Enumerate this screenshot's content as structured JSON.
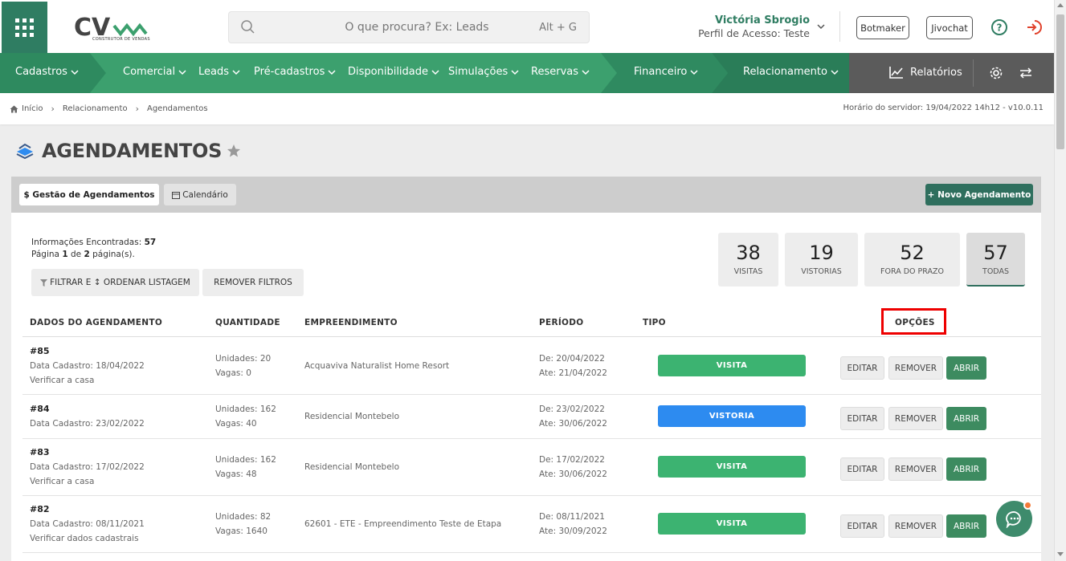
{
  "colors": {
    "brand": "#3ca06e",
    "brand_dark": "#2f7d62",
    "visita": "#3cb371",
    "vistoria": "#2d8bf0",
    "open": "#3d8b60",
    "highlight": "#ee0000"
  },
  "header": {
    "logo_sub": "CONSTRUTOR DE VENDAS",
    "search": {
      "placeholder": "O que procura? Ex: Leads",
      "shortcut": "Alt + G"
    },
    "user": {
      "name": "Victória Sbrogio",
      "role": "Perfil de Acesso: Teste"
    },
    "buttons": {
      "botmaker": "Botmaker",
      "jivochat": "Jivochat"
    }
  },
  "nav": {
    "cadastros": "Cadastros",
    "comercial": "Comercial",
    "leads": "Leads",
    "pre_cadastros": "Pré-cadastros",
    "disponibilidade": "Disponibilidade",
    "simulacoes": "Simulações",
    "reservas": "Reservas",
    "financeiro": "Financeiro",
    "relacionamento": "Relacionamento",
    "relatorios": "Relatórios"
  },
  "breadcrumb": {
    "home": "Início",
    "section": "Relacionamento",
    "current": "Agendamentos"
  },
  "server_time": "Horário do servidor: 19/04/2022 14h12 - v10.0.11",
  "page": {
    "title": "AGENDAMENTOS"
  },
  "tabs": {
    "gestao": "$ Gestão de Agendamentos",
    "calendario": "Calendário"
  },
  "new_button": "+ Novo Agendamento",
  "info": {
    "found_label": "Informações Encontradas:",
    "found_count": "57",
    "page_label": "Página",
    "page_current": "1",
    "page_of": "de",
    "page_total": "2",
    "page_suffix": "página(s)."
  },
  "filters": {
    "filter_order": "FILTRAR E ↕ ORDENAR LISTAGEM",
    "remove": "REMOVER FILTROS"
  },
  "stats": [
    {
      "num": "38",
      "label": "VISITAS"
    },
    {
      "num": "19",
      "label": "VISTORIAS"
    },
    {
      "num": "52",
      "label": "FORA DO PRAZO"
    },
    {
      "num": "57",
      "label": "TODAS"
    }
  ],
  "table": {
    "headers": [
      "DADOS DO AGENDAMENTO",
      "QUANTIDADE",
      "EMPREENDIMENTO",
      "PERÍODO",
      "TIPO",
      "OPÇÕES"
    ],
    "actions": {
      "edit": "EDITAR",
      "remove": "REMOVER",
      "open": "ABRIR"
    },
    "rows": [
      {
        "id": "#85",
        "cadastro": "Data Cadastro: 18/04/2022",
        "desc": "Verificar a casa",
        "unidades": "Unidades: 20",
        "vagas": "Vagas: 0",
        "empreendimento": "Acquaviva Naturalist Home Resort",
        "de": "De: 20/04/2022",
        "ate": "Ate: 21/04/2022",
        "tipo": "VISITA"
      },
      {
        "id": "#84",
        "cadastro": "Data Cadastro: 23/02/2022",
        "desc": "",
        "unidades": "Unidades: 162",
        "vagas": "Vagas: 40",
        "empreendimento": "Residencial Montebelo",
        "de": "De: 23/02/2022",
        "ate": "Ate: 30/06/2022",
        "tipo": "VISTORIA"
      },
      {
        "id": "#83",
        "cadastro": "Data Cadastro: 17/02/2022",
        "desc": "Verificar a casa",
        "unidades": "Unidades: 162",
        "vagas": "Vagas: 48",
        "empreendimento": "Residencial Montebelo",
        "de": "De: 17/02/2022",
        "ate": "Ate: 30/06/2022",
        "tipo": "VISITA"
      },
      {
        "id": "#82",
        "cadastro": "Data Cadastro: 08/11/2021",
        "desc": "Verificar dados cadastrais",
        "unidades": "Unidades: 82",
        "vagas": "Vagas: 1640",
        "empreendimento": "62601 - ETE - Empreendimento Teste de Etapa",
        "de": "De: 08/11/2021",
        "ate": "Ate: 30/09/2022",
        "tipo": "VISITA"
      }
    ]
  }
}
